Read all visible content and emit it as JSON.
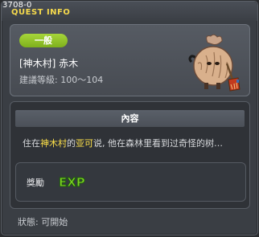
{
  "title_bar": {
    "quest_id": "3708-0",
    "title": "QUEST INFO"
  },
  "summary": {
    "category": "一般",
    "quest_name": "[神木村] 赤木",
    "level_range": "建議等級: 100～104",
    "npc_icon": "shaggy-creature-with-broom-icon"
  },
  "content": {
    "header": "內容",
    "description_parts": [
      "住在",
      "神木村",
      "的",
      "亚可",
      "说, 他在森林里看到过奇怪的树…"
    ],
    "highlight_color": "#ffe24a"
  },
  "reward": {
    "label": "獎勵",
    "exp_icon": "exp-icon",
    "exp_text": "EXP"
  },
  "status": {
    "text": "狀態:  可開始"
  },
  "colors": {
    "accent": "#f5d94c",
    "badge": "#8cc425",
    "exp_green": "#7ed321"
  }
}
